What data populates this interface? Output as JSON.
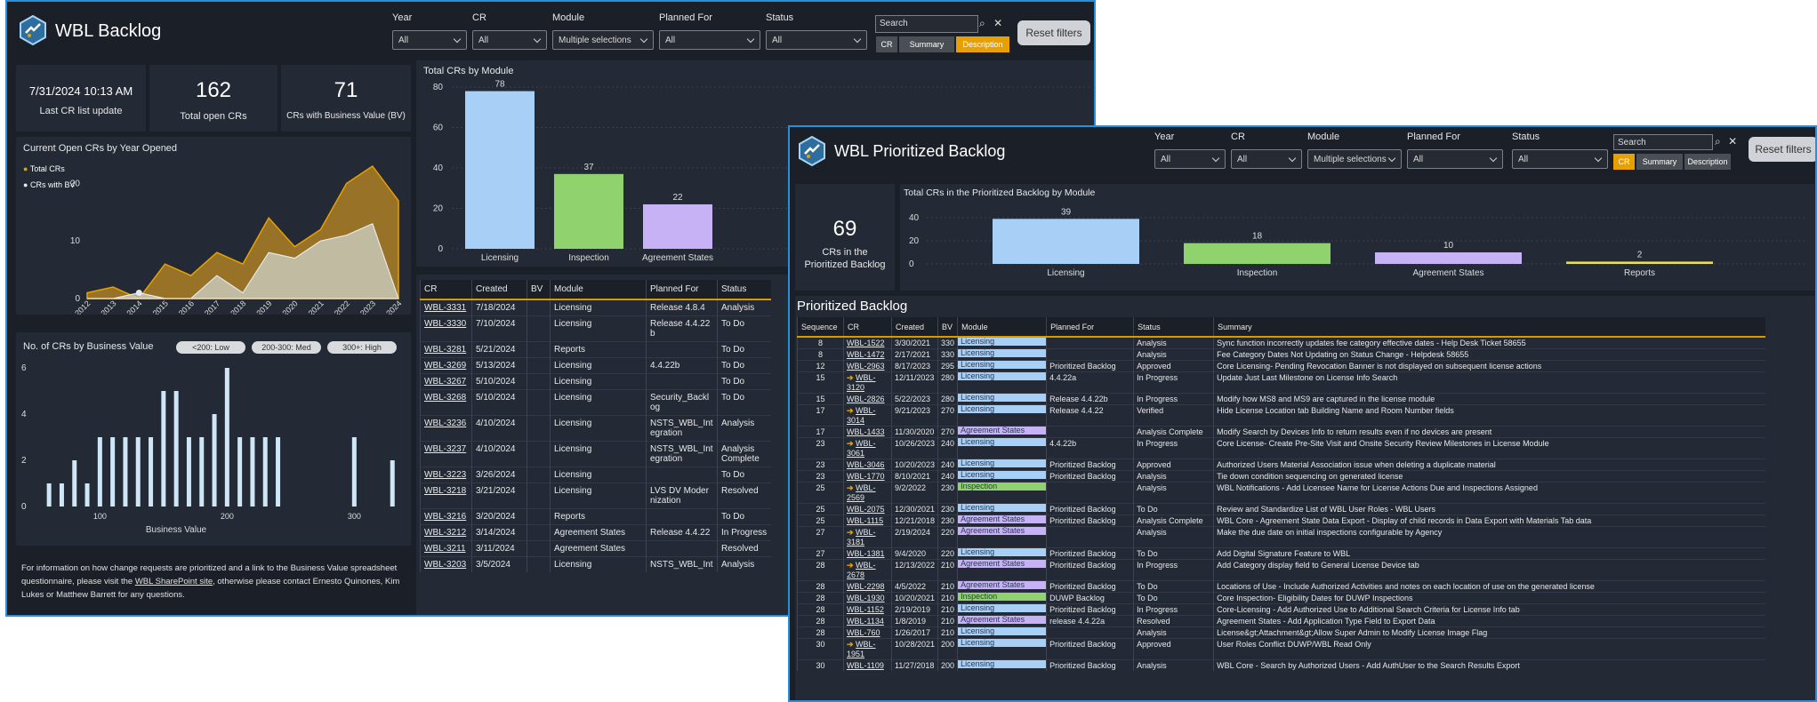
{
  "colors": {
    "accent": "#e8a000",
    "licensing": "#a8cff5",
    "inspection": "#8fd26e",
    "agreement": "#c7b2f5",
    "reports": "#e8e04a",
    "border": "#2a8fd8"
  },
  "backlog": {
    "title": "WBL Backlog",
    "filters": [
      {
        "label": "Year",
        "value": "All"
      },
      {
        "label": "CR",
        "value": "All"
      },
      {
        "label": "Module",
        "value": "Multiple selections"
      },
      {
        "label": "Planned For",
        "value": "All"
      },
      {
        "label": "Status",
        "value": "All"
      }
    ],
    "search_placeholder": "Search",
    "search_modes": [
      "CR",
      "Summary",
      "Description"
    ],
    "reset_label": "Reset filters",
    "last_update_value": "7/31/2024 10:13 AM",
    "last_update_label": "Last CR list update",
    "open_crs_value": "162",
    "open_crs_label": "Total open CRs",
    "bv_value": "71",
    "bv_label": "CRs with Business Value (BV)",
    "year_chart": {
      "title": "Current Open CRs by Year Opened",
      "legend": [
        "Total CRs",
        "CRs with BV"
      ],
      "yticks": [
        "0",
        "10",
        "20"
      ],
      "years": [
        "2012",
        "2013",
        "2014",
        "2015",
        "2016",
        "2017",
        "2018",
        "2019",
        "2020",
        "2021",
        "2022",
        "2023",
        "2024"
      ]
    },
    "bv_chart": {
      "title": "No. of CRs by Business Value",
      "pills": [
        "<200: Low",
        "200-300: Med",
        "300+: High"
      ],
      "yticks": [
        "0",
        "2",
        "4",
        "6"
      ],
      "xticks": [
        "100",
        "200",
        "300"
      ],
      "xlabel": "Business Value"
    },
    "module_chart": {
      "title": "Total CRs by Module",
      "yticks": [
        "0",
        "20",
        "40",
        "60",
        "80"
      ]
    },
    "footer_pre": "For information on how change requests are prioritized and a link to the Business Value spreadsheet questionnaire, please visit the ",
    "footer_link": "WBL SharePoint site",
    "footer_post": ", otherwise please contact Ernesto Quinones, Kim Lukes or Matthew Barrett for any questions.",
    "table": {
      "headers": [
        "CR",
        "Created",
        "BV",
        "Module",
        "Planned For",
        "Status"
      ],
      "rows": [
        [
          "WBL-3331",
          "7/18/2024",
          "",
          "Licensing",
          "Release 4.8.4",
          "Analysis"
        ],
        [
          "WBL-3330",
          "7/10/2024",
          "",
          "Licensing",
          "Release 4.4.22b",
          "To Do"
        ],
        [
          "WBL-3281",
          "5/21/2024",
          "",
          "Reports",
          "",
          "To Do"
        ],
        [
          "WBL-3269",
          "5/13/2024",
          "",
          "Licensing",
          "4.4.22b",
          "To Do"
        ],
        [
          "WBL-3267",
          "5/10/2024",
          "",
          "Licensing",
          "",
          "To Do"
        ],
        [
          "WBL-3268",
          "5/10/2024",
          "",
          "Licensing",
          "Security_Backlog",
          "To Do"
        ],
        [
          "WBL-3236",
          "4/10/2024",
          "",
          "Licensing",
          "NSTS_WBL_Integration",
          "Analysis"
        ],
        [
          "WBL-3237",
          "4/10/2024",
          "",
          "Licensing",
          "NSTS_WBL_Integration",
          "Analysis Complete"
        ],
        [
          "WBL-3223",
          "3/26/2024",
          "",
          "Licensing",
          "",
          "To Do"
        ],
        [
          "WBL-3218",
          "3/21/2024",
          "",
          "Licensing",
          "LVS DV Modernization",
          "Resolved"
        ],
        [
          "WBL-3216",
          "3/20/2024",
          "",
          "Reports",
          "",
          "To Do"
        ],
        [
          "WBL-3212",
          "3/14/2024",
          "",
          "Agreement States",
          "Release 4.4.22",
          "In Progress"
        ],
        [
          "WBL-3211",
          "3/11/2024",
          "",
          "Agreement States",
          "",
          "Resolved"
        ],
        [
          "WBL-3203",
          "3/5/2024",
          "",
          "Licensing",
          "NSTS_WBL_Int",
          "Analysis"
        ]
      ]
    }
  },
  "prioritized": {
    "title": "WBL Prioritized Backlog",
    "card_value": "69",
    "card_label": "CRs in the Prioritized Backlog",
    "chart_title": "Total CRs in the Prioritized Backlog by Module",
    "chart_yticks": [
      "0",
      "20",
      "40"
    ],
    "section_title": "Prioritized Backlog",
    "headers": [
      "Sequence",
      "CR",
      "Created",
      "BV",
      "Module",
      "Planned For",
      "Status",
      "Summary"
    ],
    "rows": [
      [
        "8",
        "",
        "WBL-1522",
        "3/30/2021",
        "330",
        "Licensing",
        "",
        "Analysis",
        "Sync function incorrectly updates fee category effective dates - Help Desk Ticket 58655"
      ],
      [
        "8",
        "",
        "WBL-1472",
        "2/17/2021",
        "330",
        "Licensing",
        "",
        "Analysis",
        "Fee Category Dates Not Updating on Status Change - Helpdesk 58655"
      ],
      [
        "12",
        "",
        "WBL-2963",
        "8/17/2023",
        "295",
        "Licensing",
        "Prioritized Backlog",
        "Approved",
        "Core Licensing- Pending Revocation Banner is not displayed on subsequent license actions"
      ],
      [
        "15",
        "➔",
        "WBL-3120",
        "12/11/2023",
        "280",
        "Licensing",
        "4.4.22a",
        "In Progress",
        "Update Just Last Milestone on License Info Search"
      ],
      [
        "15",
        "",
        "WBL-2826",
        "5/22/2023",
        "280",
        "Licensing",
        "Release 4.4.22b",
        "In Progress",
        "Modify how MS8 and MS9 are captured in the license module"
      ],
      [
        "17",
        "➔",
        "WBL-3014",
        "9/21/2023",
        "270",
        "Licensing",
        "Release 4.4.22",
        "Verified",
        "Hide License Location tab Building Name and Room Number fields"
      ],
      [
        "17",
        "",
        "WBL-1433",
        "11/30/2020",
        "270",
        "Agreement States",
        "",
        "Analysis Complete",
        "Modify Search by Devices Info to return results even if no devices are present"
      ],
      [
        "23",
        "➔",
        "WBL-3061",
        "10/26/2023",
        "240",
        "Licensing",
        "4.4.22b",
        "In Progress",
        "Core License- Create Pre-Site Visit and Onsite Security Review Milestones in License Module"
      ],
      [
        "23",
        "",
        "WBL-3046",
        "10/20/2023",
        "240",
        "Licensing",
        "Prioritized Backlog",
        "Approved",
        "Authorized Users Material Association issue when deleting a duplicate material"
      ],
      [
        "23",
        "",
        "WBL-1770",
        "8/10/2021",
        "240",
        "Licensing",
        "Prioritized Backlog",
        "Analysis",
        "Tie down condition sequencing on generated license"
      ],
      [
        "25",
        "➔",
        "WBL-2569",
        "9/2/2022",
        "230",
        "Inspection",
        "",
        "Analysis",
        "WBL Notifications - Add Licensee Name for License Actions Due and Inspections Assigned"
      ],
      [
        "25",
        "",
        "WBL-2075",
        "12/30/2021",
        "230",
        "Licensing",
        "Prioritized Backlog",
        "To Do",
        "Review and Standardize List of WBL User Roles - WBL Users"
      ],
      [
        "25",
        "",
        "WBL-1115",
        "12/21/2018",
        "230",
        "Agreement States",
        "Prioritized Backlog",
        "Analysis Complete",
        "WBL Core - Agreement State Data Export - Display of child records in Data Export with Materials Tab data"
      ],
      [
        "27",
        "➔",
        "WBL-3181",
        "2/19/2024",
        "220",
        "Agreement States",
        "",
        "Analysis",
        "Make the due date on initial inspections configurable by Agency"
      ],
      [
        "27",
        "",
        "WBL-1381",
        "9/4/2020",
        "220",
        "Licensing",
        "Prioritized Backlog",
        "To Do",
        "Add Digital Signature Feature to WBL"
      ],
      [
        "28",
        "➔",
        "WBL-2678",
        "12/13/2022",
        "210",
        "Agreement States",
        "Prioritized Backlog",
        "In Progress",
        "Add Category display field to General License Device tab"
      ],
      [
        "28",
        "",
        "WBL-2298",
        "4/5/2022",
        "210",
        "Agreement States",
        "Prioritized Backlog",
        "To Do",
        "Locations of Use - Include Authorized Activities and notes on each location of use on the generated license"
      ],
      [
        "28",
        "",
        "WBL-1930",
        "10/20/2021",
        "210",
        "Inspection",
        "DUWP Backlog",
        "To Do",
        "Core Inspection- Eligibility Dates for DUWP Inspections"
      ],
      [
        "28",
        "",
        "WBL-1152",
        "2/19/2019",
        "210",
        "Licensing",
        "Prioritized Backlog",
        "In Progress",
        "Core-Licensing - Add Authorized Use to Additional Search Criteria for License Info tab"
      ],
      [
        "28",
        "",
        "WBL-1134",
        "1/8/2019",
        "210",
        "Agreement States",
        "release 4.4.22a",
        "Resolved",
        "Agreement States - Add Application Type Field to Export Data"
      ],
      [
        "28",
        "",
        "WBL-760",
        "1/26/2017",
        "210",
        "Licensing",
        "",
        "Analysis",
        "License&gt;Attachment&gt;Allow Super Admin to Modify License Image Flag"
      ],
      [
        "30",
        "➔",
        "WBL-1951",
        "10/28/2021",
        "200",
        "Licensing",
        "Prioritized Backlog",
        "Approved",
        "User Roles Conflict DUWP/WBL Read Only"
      ],
      [
        "30",
        "",
        "WBL-1109",
        "11/27/2018",
        "200",
        "Licensing",
        "Prioritized Backlog",
        "Analysis",
        "WBL Core - Search by Authorized Users - Add AuthUser to the Search Results Export"
      ]
    ]
  },
  "chart_data": [
    {
      "type": "bar",
      "title": "Total CRs by Module",
      "categories": [
        "Licensing",
        "Inspection",
        "Agreement States"
      ],
      "values": [
        78,
        37,
        22
      ],
      "ylim": [
        0,
        80
      ]
    },
    {
      "type": "area",
      "title": "Current Open CRs by Year Opened",
      "x": [
        "2012",
        "2013",
        "2014",
        "2015",
        "2016",
        "2017",
        "2018",
        "2019",
        "2020",
        "2021",
        "2022",
        "2023",
        "2024"
      ],
      "series": [
        {
          "name": "Total CRs",
          "values": [
            1,
            2,
            0,
            6,
            4,
            8,
            6,
            14,
            9,
            12,
            20,
            23,
            17
          ]
        },
        {
          "name": "CRs with BV",
          "values": [
            0,
            0,
            1,
            0,
            0,
            4,
            1,
            8,
            7,
            10,
            11,
            13,
            0
          ]
        }
      ],
      "ylim": [
        0,
        25
      ]
    },
    {
      "type": "bar",
      "title": "No. of CRs by Business Value",
      "xlabel": "Business Value",
      "x": [
        60,
        70,
        80,
        90,
        100,
        110,
        120,
        130,
        140,
        150,
        160,
        170,
        180,
        190,
        200,
        210,
        220,
        230,
        240,
        300,
        330
      ],
      "values": [
        1,
        1,
        2,
        1,
        3,
        3,
        3,
        3,
        3,
        5,
        5,
        3,
        3,
        4,
        6,
        3,
        3,
        3,
        3,
        3,
        2
      ],
      "ylim": [
        0,
        6
      ]
    },
    {
      "type": "bar",
      "title": "Total CRs in the Prioritized Backlog by Module",
      "categories": [
        "Licensing",
        "Inspection",
        "Agreement States",
        "Reports"
      ],
      "values": [
        39,
        18,
        10,
        2
      ],
      "ylim": [
        0,
        40
      ]
    }
  ]
}
